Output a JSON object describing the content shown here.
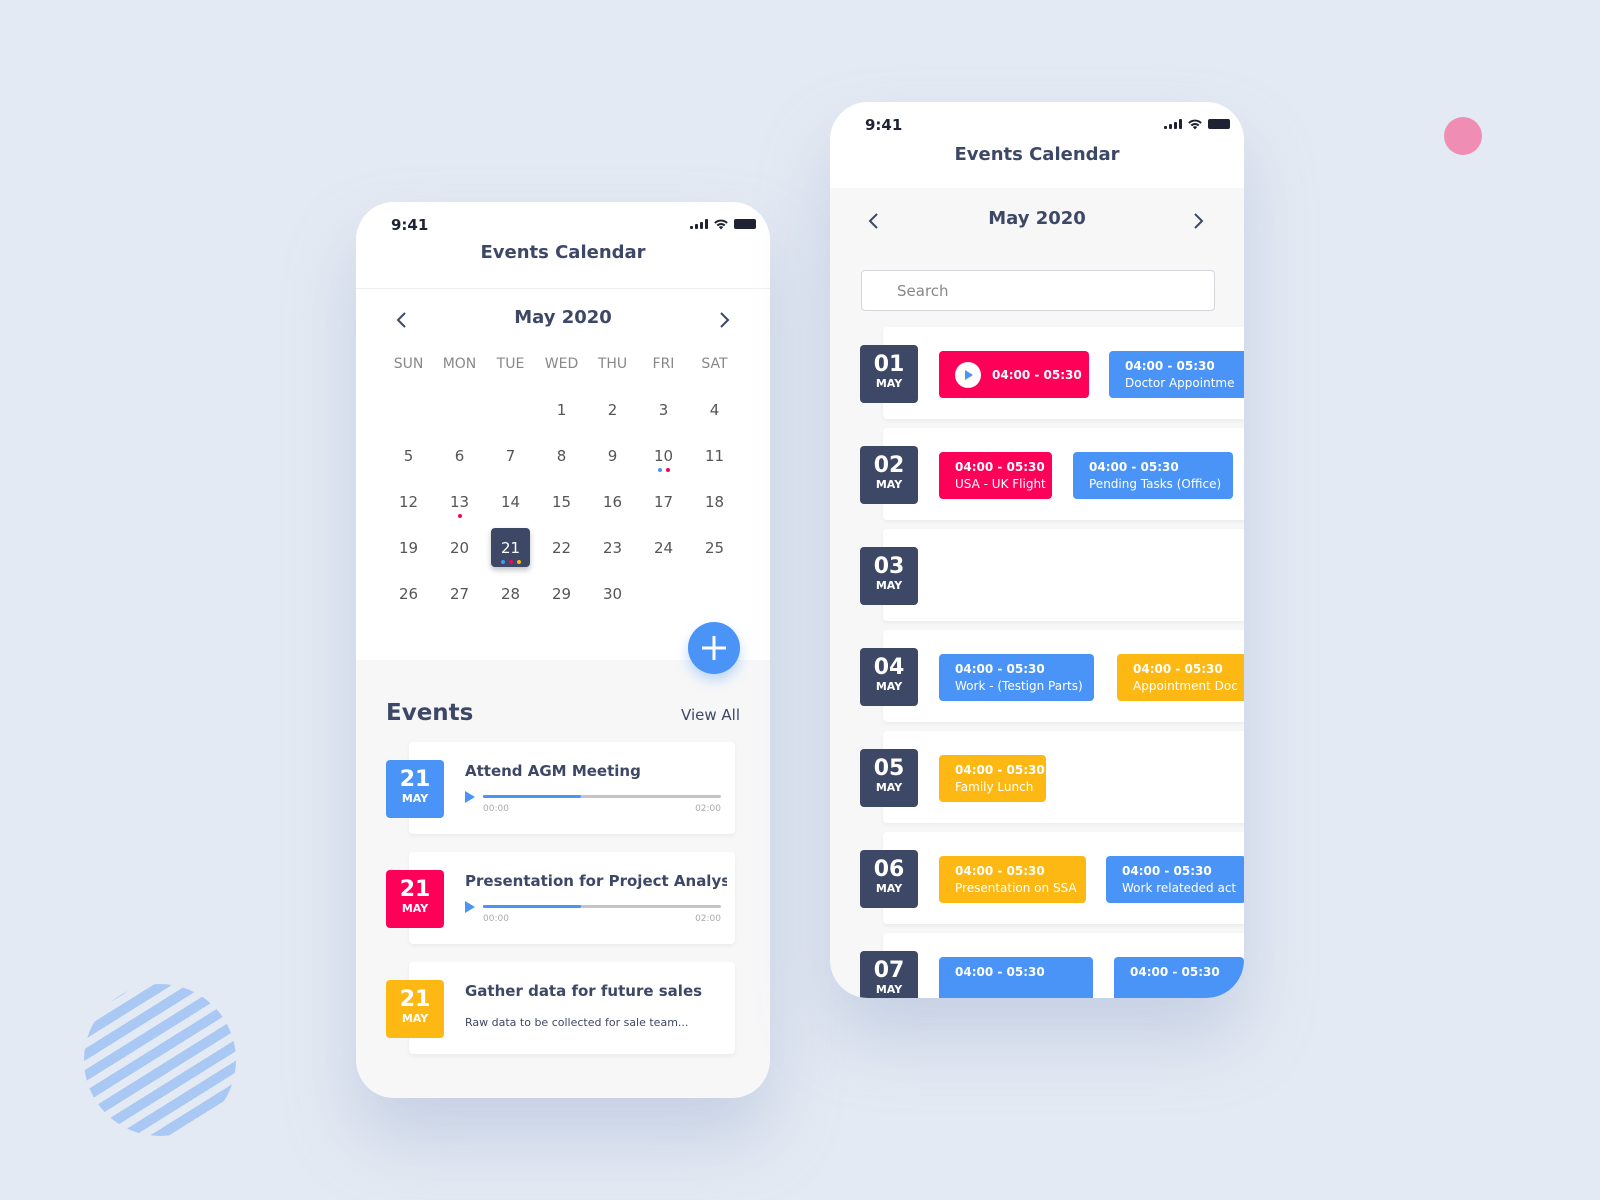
{
  "colors": {
    "background": "#e4eaf3",
    "navy": "#3d4766",
    "blue": "#4a94f7",
    "pink": "#ff0058",
    "yellow": "#fdb813",
    "deco_pink": "#ef8db5",
    "deco_stripe": "#a9c8f4"
  },
  "left_phone": {
    "status": {
      "time": "9:41"
    },
    "title": "Events Calendar",
    "month_label": "May 2020",
    "weekdays": [
      "SUN",
      "MON",
      "TUE",
      "WED",
      "THU",
      "FRI",
      "SAT"
    ],
    "weeks": [
      [
        "",
        "",
        "",
        "1",
        "2",
        "3",
        "4"
      ],
      [
        "5",
        "6",
        "7",
        "8",
        "9",
        "10",
        "11"
      ],
      [
        "12",
        "13",
        "14",
        "15",
        "16",
        "17",
        "18"
      ],
      [
        "19",
        "20",
        "21",
        "22",
        "23",
        "24",
        "25"
      ],
      [
        "26",
        "27",
        "28",
        "29",
        "30",
        "",
        ""
      ]
    ],
    "selected_day": "21",
    "event_dots": {
      "10": [
        "blue",
        "pink"
      ],
      "13": [
        "pink"
      ],
      "21": [
        "blue",
        "pink",
        "yellow"
      ]
    },
    "events_heading": "Events",
    "view_all": "View All",
    "events": [
      {
        "day": "21",
        "month": "MAY",
        "color": "blue",
        "title": "Attend AGM Meeting",
        "type": "audio",
        "progress": 0.41,
        "start": "00:00",
        "end": "02:00"
      },
      {
        "day": "21",
        "month": "MAY",
        "color": "pink",
        "title": "Presentation for Project Analys...",
        "type": "audio",
        "progress": 0.41,
        "start": "00:00",
        "end": "02:00"
      },
      {
        "day": "21",
        "month": "MAY",
        "color": "yellow",
        "title": "Gather data for future sales",
        "type": "text",
        "subtitle": "Raw data to be collected for sale team..."
      }
    ]
  },
  "right_phone": {
    "status": {
      "time": "9:41"
    },
    "title": "Events Calendar",
    "month_label": "May 2020",
    "search_placeholder": "Search",
    "days": [
      {
        "day": "01",
        "month": "MAY",
        "chips": [
          {
            "color": "pink",
            "time": "04:00 - 05:30",
            "label": "",
            "play": true
          },
          {
            "color": "blue",
            "time": "04:00 - 05:30",
            "label": "Doctor Appointme"
          }
        ]
      },
      {
        "day": "02",
        "month": "MAY",
        "chips": [
          {
            "color": "pink",
            "time": "04:00 - 05:30",
            "label": "USA - UK Flight"
          },
          {
            "color": "blue",
            "time": "04:00 - 05:30",
            "label": "Pending Tasks (Office)"
          }
        ]
      },
      {
        "day": "03",
        "month": "MAY",
        "chips": []
      },
      {
        "day": "04",
        "month": "MAY",
        "chips": [
          {
            "color": "blue",
            "time": "04:00 - 05:30",
            "label": "Work - (Testign Parts)"
          },
          {
            "color": "yellow",
            "time": "04:00 - 05:30",
            "label": "Appointment Doc"
          }
        ]
      },
      {
        "day": "05",
        "month": "MAY",
        "chips": [
          {
            "color": "yellow",
            "time": "04:00 - 05:30",
            "label": "Family Lunch"
          }
        ]
      },
      {
        "day": "06",
        "month": "MAY",
        "chips": [
          {
            "color": "yellow",
            "time": "04:00 - 05:30",
            "label": "Presentation on SSA"
          },
          {
            "color": "blue",
            "time": "04:00 - 05:30",
            "label": "Work relateded act"
          }
        ]
      },
      {
        "day": "07",
        "month": "MAY",
        "chips": [
          {
            "color": "blue",
            "time": "04:00 - 05:30",
            "label": ""
          },
          {
            "color": "blue",
            "time": "04:00 - 05:30",
            "label": ""
          }
        ]
      }
    ]
  }
}
